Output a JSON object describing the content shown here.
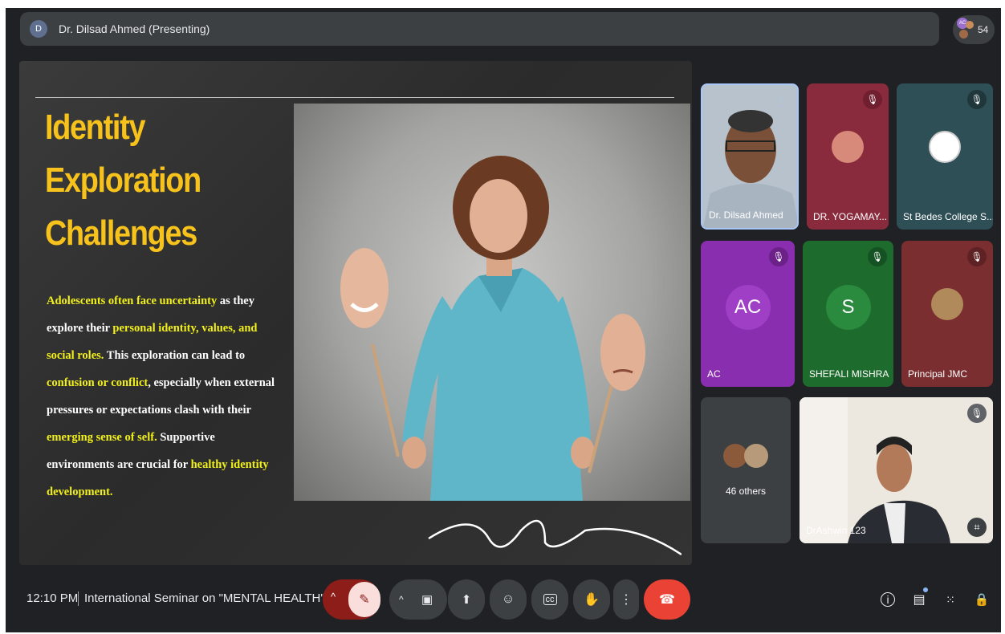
{
  "header": {
    "presenter_initial": "D",
    "presenter_label": "Dr. Dilsad Ahmed (Presenting)",
    "participant_count": "54",
    "count_avatar_initials": "AC"
  },
  "slide": {
    "title_lines": [
      "Identity",
      "Exploration",
      "Challenges"
    ],
    "body": [
      {
        "t": "Adolescents often face uncertainty",
        "hl": true
      },
      {
        "t": " as they explore their ",
        "hl": false
      },
      {
        "t": "personal identity, values, and social roles.",
        "hl": true
      },
      {
        "t": " This exploration can lead to ",
        "hl": false
      },
      {
        "t": "confusion or conflict",
        "hl": true
      },
      {
        "t": ", especially when external pressures or expectations clash with their ",
        "hl": false
      },
      {
        "t": "emerging sense of self.",
        "hl": true
      },
      {
        "t": " Supportive environments are crucial for ",
        "hl": false
      },
      {
        "t": "healthy identity development.",
        "hl": true
      }
    ]
  },
  "participants": [
    {
      "name": "Dr. Dilsad Ahmed",
      "state": "speaking"
    },
    {
      "name": "DR. YOGAMAY...",
      "state": "muted"
    },
    {
      "name": "St Bedes College S...",
      "state": "muted"
    },
    {
      "name": "AC",
      "initials": "AC",
      "state": "muted"
    },
    {
      "name": "SHEFALI MISHRA",
      "initials": "S",
      "state": "muted"
    },
    {
      "name": "Principal JMC",
      "state": "muted"
    },
    {
      "name": "DrAshwin 123",
      "state": "muted"
    }
  ],
  "others": {
    "label": "46 others"
  },
  "footer": {
    "time": "12:10 PM",
    "meeting_title": "International Seminar on \"MENTAL HEALTH\""
  },
  "colors": {
    "background": "#202124",
    "title_yellow": "#f6c21b",
    "highlight": "#f2f01a",
    "end_call": "#ea4335",
    "mic_off_bg": "#f9dedc"
  },
  "icons": [
    "mic-off-icon",
    "camera-icon",
    "present-icon",
    "emoji-icon",
    "captions-icon",
    "raise-hand-icon",
    "more-icon",
    "end-call-icon",
    "info-icon",
    "chat-icon",
    "activities-icon",
    "host-controls-icon"
  ]
}
